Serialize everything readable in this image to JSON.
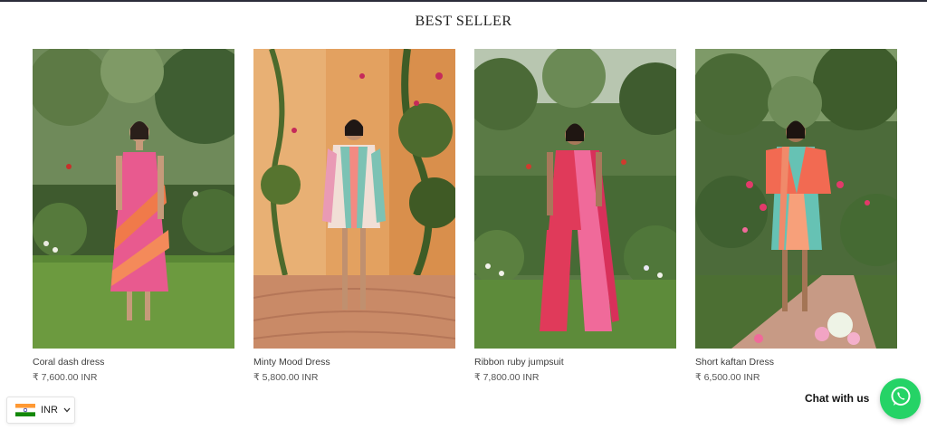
{
  "section": {
    "title": "BEST SELLER"
  },
  "products": [
    {
      "name": "Coral dash dress",
      "price": "₹ 7,600.00 INR",
      "image": "model-in-pink-coral-striped-dress-garden"
    },
    {
      "name": "Minty Mood Dress",
      "price": "₹ 5,800.00 INR",
      "image": "model-in-mint-pink-striped-mini-dress-wall"
    },
    {
      "name": "Ribbon ruby jumpsuit",
      "price": "₹ 7,800.00 INR",
      "image": "model-in-pink-ruby-jumpsuit-garden"
    },
    {
      "name": "Short kaftan Dress",
      "price": "₹ 6,500.00 INR",
      "image": "model-in-teal-coral-kaftan-garden-path"
    }
  ],
  "currency": {
    "label": "INR",
    "flag": "india-flag-icon"
  },
  "chat": {
    "label": "Chat with us",
    "icon": "whatsapp-icon"
  },
  "colors": {
    "whatsapp": "#25d366",
    "topbar": "#2b2d3a"
  }
}
